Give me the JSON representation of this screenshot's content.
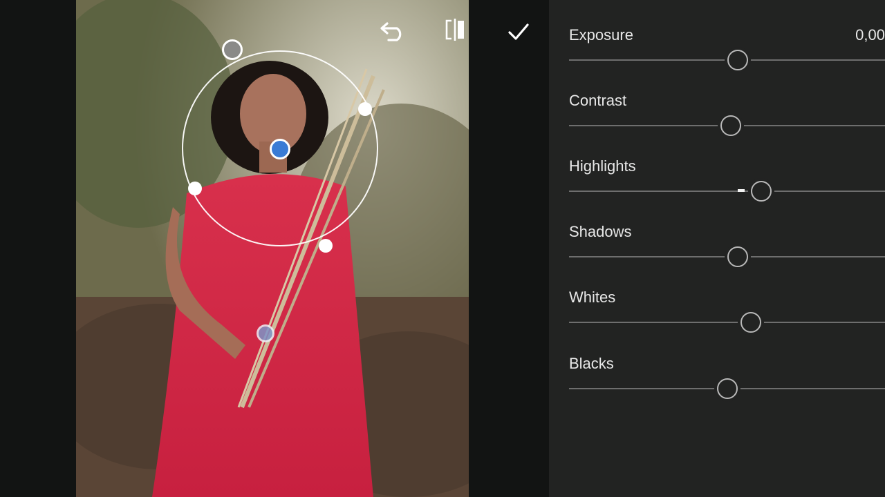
{
  "toolbar": {
    "undo_icon": "undo-icon",
    "compare_icon": "compare-icon",
    "confirm_icon": "check-icon"
  },
  "adjustments": {
    "exposure": {
      "label": "Exposure",
      "value": "0,00",
      "level": 0.535
    },
    "contrast": {
      "label": "Contrast",
      "level": 0.512
    },
    "highlights": {
      "label": "Highlights",
      "level": 0.608
    },
    "shadows": {
      "label": "Shadows",
      "level": 0.535
    },
    "whites": {
      "label": "Whites",
      "level": 0.576
    },
    "blacks": {
      "label": "Blacks",
      "level": 0.502
    }
  },
  "colors": {
    "panel_bg": "#222322",
    "pin_active": "#3a7bd5",
    "track": "#6e6e6e"
  }
}
